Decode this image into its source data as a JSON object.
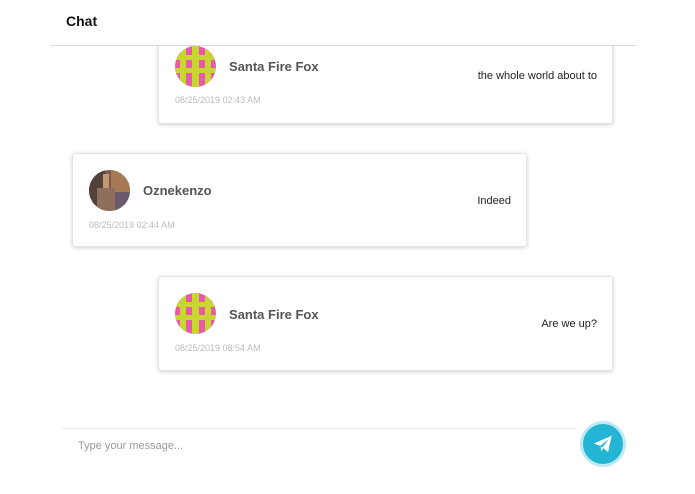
{
  "header": {
    "title": "Chat"
  },
  "messages": [
    {
      "side": "right",
      "sender": "Santa Fire Fox",
      "text": "the whole world about to",
      "time": "08/25/2019 02:43 AM",
      "avatar": "identicon-avatar"
    },
    {
      "side": "left",
      "sender": "Oznekenzo",
      "text": "Indeed",
      "time": "08/25/2019 02:44 AM",
      "avatar": "photo-avatar"
    },
    {
      "side": "right",
      "sender": "Santa Fire Fox",
      "text": "Are we up?",
      "time": "08/25/2019 08:54 AM",
      "avatar": "identicon-avatar"
    }
  ],
  "composer": {
    "placeholder": "Type your message...",
    "value": ""
  },
  "send_button": {
    "icon": "paper-plane-icon",
    "color": "#23b5d3"
  }
}
